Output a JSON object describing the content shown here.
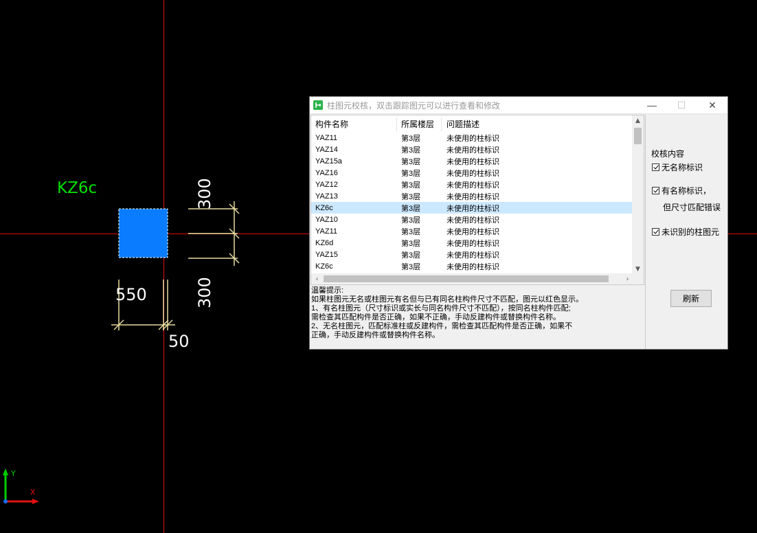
{
  "cad": {
    "component_label": "KZ6c",
    "dim_top": "300",
    "dim_bottom": "300",
    "dim_left": "550",
    "dim_right": "50",
    "axis_y": "Y",
    "axis_x": "X"
  },
  "dialog": {
    "title": "柱图元校核，双击跟踪图元可以进行查看和修改",
    "columns": [
      "构件名称",
      "所属楼层",
      "问题描述"
    ],
    "rows": [
      {
        "name": "YAZ11",
        "floor": "第3层",
        "issue": "未使用的柱标识"
      },
      {
        "name": "YAZ14",
        "floor": "第3层",
        "issue": "未使用的柱标识"
      },
      {
        "name": "YAZ15a",
        "floor": "第3层",
        "issue": "未使用的柱标识"
      },
      {
        "name": "YAZ16",
        "floor": "第3层",
        "issue": "未使用的柱标识"
      },
      {
        "name": "YAZ12",
        "floor": "第3层",
        "issue": "未使用的柱标识"
      },
      {
        "name": "YAZ13",
        "floor": "第3层",
        "issue": "未使用的柱标识"
      },
      {
        "name": "KZ6c",
        "floor": "第3层",
        "issue": "未使用的柱标识"
      },
      {
        "name": "YAZ10",
        "floor": "第3层",
        "issue": "未使用的柱标识"
      },
      {
        "name": "YAZ11",
        "floor": "第3层",
        "issue": "未使用的柱标识"
      },
      {
        "name": "KZ6d",
        "floor": "第3层",
        "issue": "未使用的柱标识"
      },
      {
        "name": "YAZ15",
        "floor": "第3层",
        "issue": "未使用的柱标识"
      },
      {
        "name": "KZ6c",
        "floor": "第3层",
        "issue": "未使用的柱标识"
      }
    ],
    "selected_row": 6,
    "tips": [
      "温馨提示:",
      "如果柱图元无名或柱图元有名但与已有同名柱构件尺寸不匹配，图元以红色显示。",
      "1、有名柱图元（尺寸标识或实长与同名构件尺寸不匹配），按同名柱构件匹配;",
      "需检查其匹配构件是否正确，如果不正确，手动反建构件或替换构件名称。",
      "2、无名柱图元，匹配标准柱或反建构件，需检查其匹配构件是否正确，如果不",
      "正确，手动反建构件或替换构件名称。"
    ],
    "check_title": "校核内容",
    "check1": "无名称标识",
    "check2_line1": "有名称标识，",
    "check2_line2": "但尺寸匹配错误",
    "check3": "未识别的柱图元",
    "refresh": "刷新"
  },
  "colors": {
    "column_fill": "#0a7cff",
    "label_green": "#00e000",
    "dim_line": "#e8dca0",
    "axis_red": "#e01010",
    "selected_row": "#cce8ff"
  }
}
